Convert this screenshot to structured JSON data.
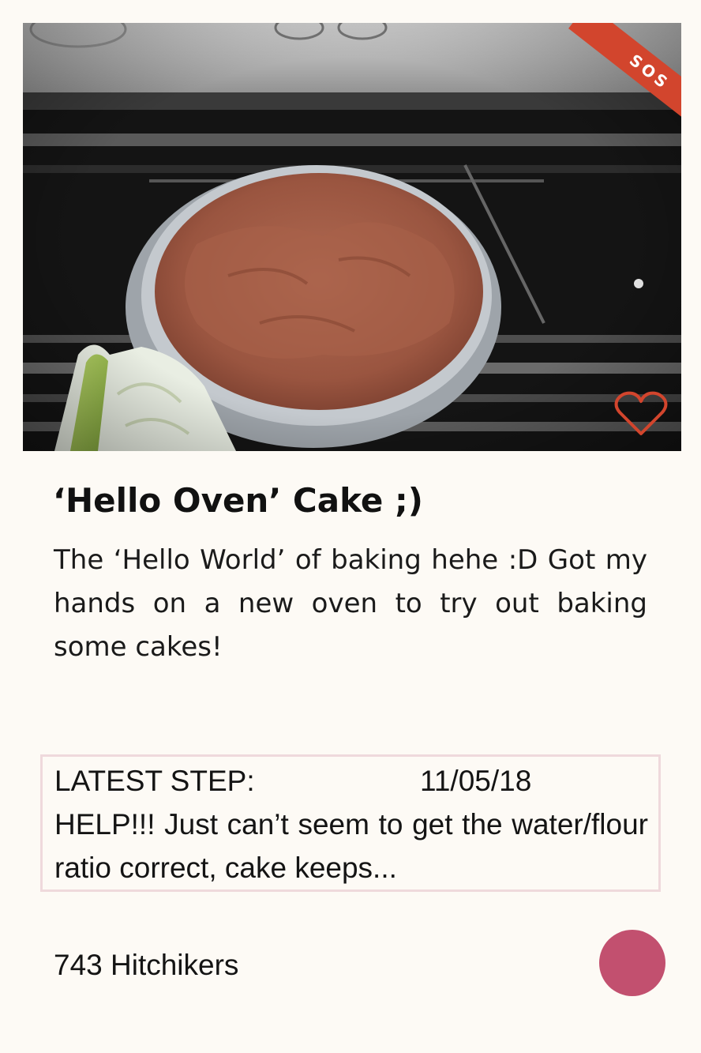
{
  "card": {
    "badge": "SOS",
    "title": "‘Hello Oven’ Cake ;)",
    "description": "The ‘Hello World’ of baking hehe :D Got my hands on a new oven to try out baking some cakes!",
    "latest_step": {
      "label": "LATEST STEP:",
      "date": "11/05/18",
      "text": "HELP!!! Just can’t seem to get the water/flour ratio correct, cake keeps..."
    },
    "followers": "743 Hitchikers"
  },
  "icons": {
    "favorite": "heart-outline-icon",
    "action": "circle-button"
  },
  "colors": {
    "background": "#fdfaf5",
    "badge": "#d2452d",
    "heart": "#d2452d",
    "step_border": "#efd9dc",
    "action_dot": "#c2506f"
  }
}
